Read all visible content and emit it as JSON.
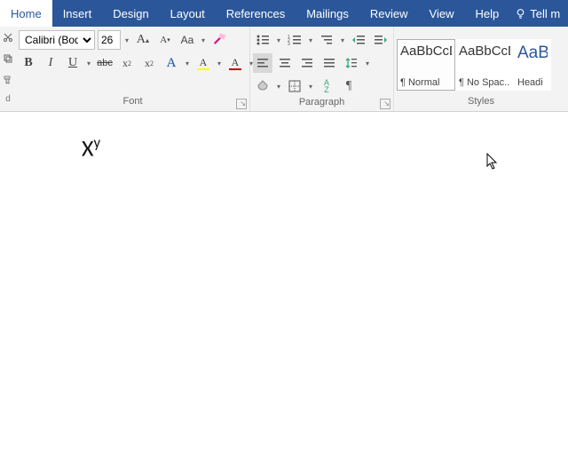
{
  "tabs": {
    "home": "Home",
    "insert": "Insert",
    "design": "Design",
    "layout": "Layout",
    "references": "References",
    "mailings": "Mailings",
    "review": "Review",
    "view": "View",
    "help": "Help",
    "tellme": "Tell m"
  },
  "font": {
    "group_label": "Font",
    "name": "Calibri (Body)",
    "size": "26",
    "grow": "A",
    "shrink": "A",
    "changecase": "Aa",
    "bold": "B",
    "italic": "I",
    "underline": "U",
    "strike": "abc",
    "subscript_base": "x",
    "subscript_sub": "2",
    "superscript_base": "x",
    "superscript_sup": "2",
    "texteffects": "A",
    "highlight": "A",
    "fontcolor": "A"
  },
  "paragraph": {
    "group_label": "Paragraph",
    "sort": "A",
    "sort2": "Z"
  },
  "styles": {
    "group_label": "Styles",
    "sample": "AaBbCcDc",
    "head_sample": "AaB",
    "normal": "¶ Normal",
    "nospacing": "¶ No Spac...",
    "heading1": "Headi"
  },
  "document": {
    "base": "X",
    "sup": "y"
  }
}
